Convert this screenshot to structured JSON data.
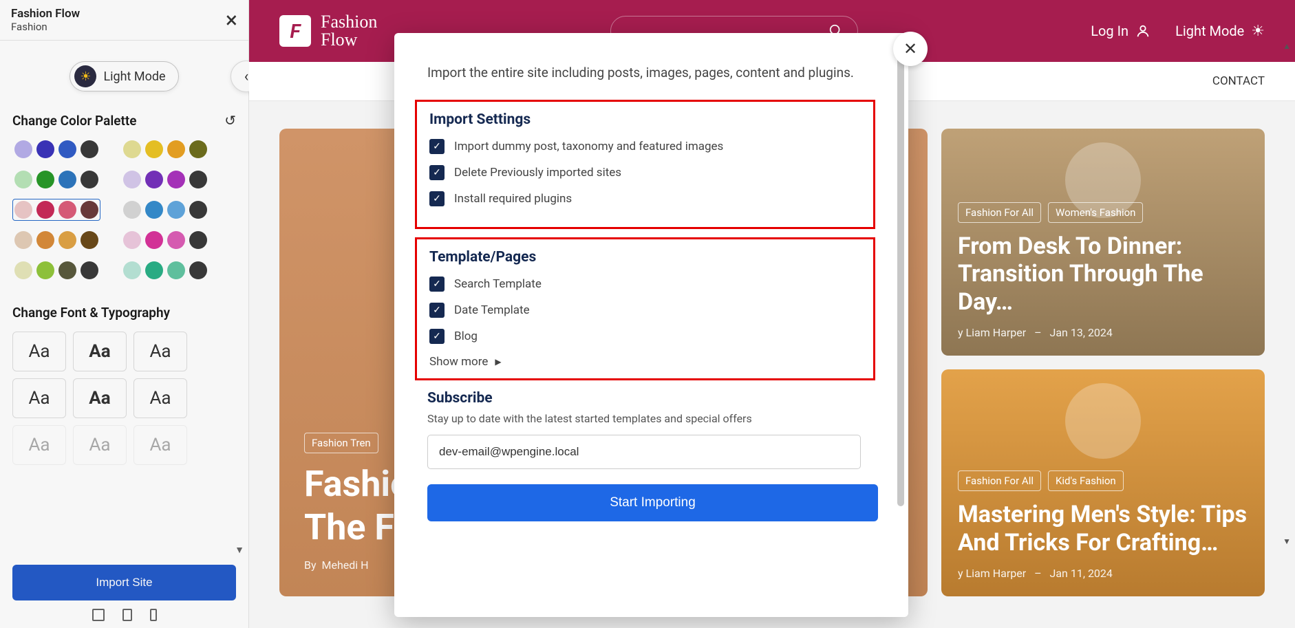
{
  "sidebar": {
    "title": "Fashion Flow",
    "subtitle": "Fashion",
    "light_mode_label": "Light Mode",
    "palette_title": "Change Color Palette",
    "palettes": [
      [
        [
          "#b7aef0",
          "#3a32c8",
          "#2d5dd4",
          "#3a3a3a"
        ],
        [
          "#e6e08e",
          "#f0c414",
          "#f0a114",
          "#6f6f14"
        ]
      ],
      [
        [
          "#b5e6b5",
          "#1f9c1f",
          "#2678c8",
          "#3a3a3a"
        ],
        [
          "#d7c8ef",
          "#7a2fc8",
          "#b22fc8",
          "#3a3a3a"
        ]
      ],
      [
        [
          "#f0c8c8",
          "#d6265a",
          "#e65a7a",
          "#6f3a3a"
        ],
        [
          "#d7d7d7",
          "#2d8ed6",
          "#5aa8e6",
          "#3a3a3a"
        ]
      ],
      [
        [
          "#e6cdb5",
          "#e08a2f",
          "#e6a23a",
          "#6f4a14"
        ],
        [
          "#f0c8e0",
          "#e62fa1",
          "#e65abb",
          "#3a3a3a"
        ]
      ],
      [
        [
          "#e6e6b5",
          "#8ec82f",
          "#5a5a3a",
          "#3a3a3a"
        ],
        [
          "#b5e6d7",
          "#1fb486",
          "#5ac8a1",
          "#3a3a3a"
        ]
      ]
    ],
    "selected_palette_row": 2,
    "selected_palette_col": 0,
    "typography_title": "Change Font & Typography",
    "import_button": "Import Site"
  },
  "header": {
    "brand_top": "Fashion",
    "brand_bottom": "Flow",
    "login": "Log In",
    "light_mode": "Light Mode"
  },
  "nav": {
    "contact": "CONTACT"
  },
  "cards": {
    "hero": {
      "tag": "Fashion Tren",
      "title_prefix": "Fashion",
      "title_line2": "The F",
      "by": "By",
      "author": "Mehedi H"
    },
    "side1": {
      "tag1": "Fashion For All",
      "tag2": "Women's Fashion",
      "title": "From Desk To Dinner: Transition Through The Day…",
      "by": "y",
      "author": "Liam Harper",
      "sep": "–",
      "date": "Jan 13, 2024"
    },
    "side2": {
      "tag1": "Fashion For All",
      "tag2": "Kid's Fashion",
      "title": "Mastering Men's Style: Tips And Tricks For Crafting…",
      "by": "y",
      "author": "Liam Harper",
      "sep": "–",
      "date": "Jan 11, 2024"
    }
  },
  "modal": {
    "intro": "Import the entire site including posts, images, pages, content and plugins.",
    "import_settings_title": "Import Settings",
    "import_settings": [
      "Import dummy post, taxonomy and featured images",
      "Delete Previously imported sites",
      "Install required plugins"
    ],
    "template_pages_title": "Template/Pages",
    "template_pages": [
      "Search Template",
      "Date Template",
      "Blog"
    ],
    "show_more": "Show more",
    "subscribe_title": "Subscribe",
    "subscribe_desc": "Stay up to date with the latest started templates and special offers",
    "email_value": "dev-email@wpengine.local",
    "start_button": "Start Importing"
  }
}
